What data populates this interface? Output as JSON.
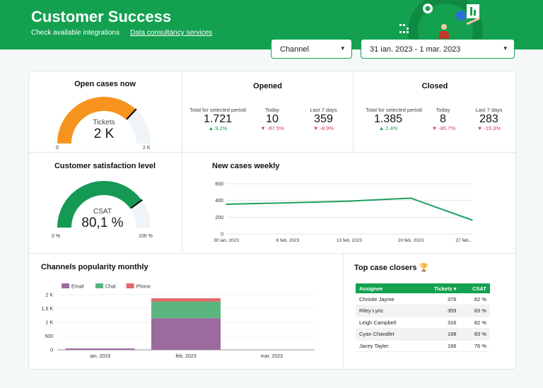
{
  "header": {
    "title": "Customer Success",
    "link1": "Check available integrations",
    "link2": "Data consultancy services"
  },
  "filters": {
    "channel": "Channel",
    "date_range": "31 ian. 2023 - 1 mar. 2023"
  },
  "open_cases": {
    "title": "Open cases now",
    "label": "Tickets",
    "value": "2 K",
    "min": "0",
    "max": "2 K",
    "fraction": 0.74
  },
  "opened": {
    "title": "Opened",
    "metrics": [
      {
        "label": "Total for selected period",
        "value": "1.721",
        "delta": "9.2%",
        "dir": "up"
      },
      {
        "label": "Today",
        "value": "10",
        "delta": "-87.5%",
        "dir": "down"
      },
      {
        "label": "Last 7 days",
        "value": "359",
        "delta": "-8.9%",
        "dir": "down"
      }
    ]
  },
  "closed": {
    "title": "Closed",
    "metrics": [
      {
        "label": "Total for selected period",
        "value": "1.385",
        "delta": "2.4%",
        "dir": "up"
      },
      {
        "label": "Today",
        "value": "8",
        "delta": "-85.7%",
        "dir": "down"
      },
      {
        "label": "Last 7 days",
        "value": "283",
        "delta": "-15.3%",
        "dir": "down"
      }
    ]
  },
  "csat": {
    "title": "Customer satisfaction level",
    "label": "CSAT",
    "value": "80,1 %",
    "min": "0 %",
    "max": "100 %",
    "fraction": 0.801
  },
  "new_cases": {
    "title": "New cases weekly"
  },
  "channels": {
    "title": "Channels popularity monthly"
  },
  "top_closers": {
    "title": "Top case closers 🏆",
    "headers": [
      "Assignee",
      "Tickets ▾",
      "CSAT"
    ],
    "rows": [
      [
        "Christie Jayme",
        "376",
        "82 %"
      ],
      [
        "Riley Lyric",
        "359",
        "83 %"
      ],
      [
        "Leigh Campbell",
        "316",
        "82 %"
      ],
      [
        "Cyan Chandler",
        "168",
        "83 %"
      ],
      [
        "Jacey Tayler",
        "166",
        "76 %"
      ]
    ]
  },
  "chart_data": [
    {
      "type": "line",
      "title": "New cases weekly",
      "x": [
        "30 ian. 2023",
        "6 feb. 2023",
        "13 feb. 2023",
        "20 feb. 2023",
        "27 feb..."
      ],
      "series": [
        {
          "values": [
            355,
            372,
            392,
            428,
            165
          ]
        }
      ],
      "ylim": [
        0,
        600
      ],
      "yticks": [
        "0",
        "200",
        "400",
        "600"
      ],
      "grid": true,
      "color": "#1e9e5e"
    },
    {
      "type": "bar",
      "stacked": true,
      "title": "Channels popularity monthly",
      "categories": [
        "ian. 2023",
        "feb. 2023",
        "mar. 2023"
      ],
      "series": [
        {
          "name": "Email",
          "values": [
            50,
            1150,
            0
          ],
          "color": "#9b6b9e"
        },
        {
          "name": "Chat",
          "values": [
            0,
            600,
            0
          ],
          "color": "#5ab67e"
        },
        {
          "name": "Phone",
          "values": [
            0,
            120,
            0
          ],
          "color": "#e06a6a"
        }
      ],
      "ylim": [
        0,
        2000
      ],
      "yticks": [
        "0",
        "500",
        "1 K",
        "1,5 K",
        "2 K"
      ],
      "legend": "top"
    }
  ]
}
